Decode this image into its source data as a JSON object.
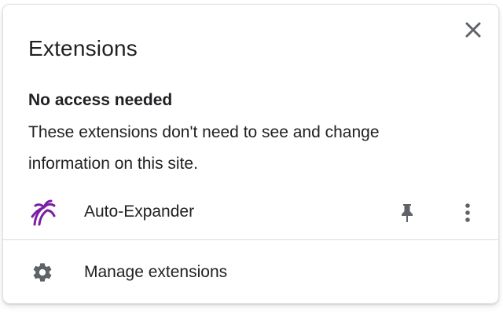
{
  "popup": {
    "title": "Extensions",
    "close_icon": "close-icon"
  },
  "section": {
    "heading": "No access needed",
    "description": "These extensions don't need to see and change information on this site."
  },
  "extensions": [
    {
      "name": "Auto-Expander",
      "icon": "auto-expander-icon",
      "icon_color": "#7b1fa2",
      "pin_icon": "pin-icon",
      "menu_icon": "more-vert-icon"
    }
  ],
  "footer": {
    "manage_label": "Manage extensions",
    "manage_icon": "gear-icon"
  },
  "colors": {
    "text": "#202124",
    "icon_gray": "#5f6368",
    "divider": "#dadce0"
  }
}
